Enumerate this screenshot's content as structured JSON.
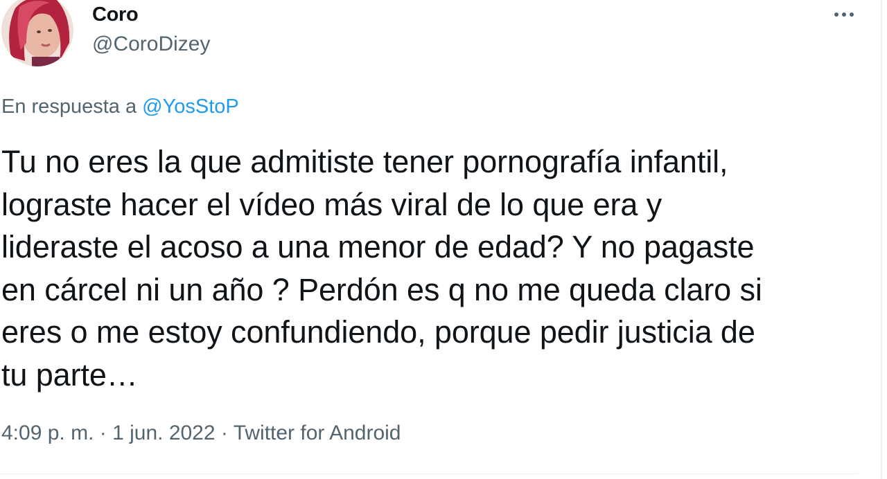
{
  "author": {
    "display_name": "Coro",
    "handle": "@CoroDizey"
  },
  "reply": {
    "prefix": "En respuesta a",
    "mention": "@YosStoP"
  },
  "tweet": {
    "text": "Tu no eres la que admitiste tener pornografía infantil,\nlograste hacer el vídeo más viral de lo que era y\nlideraste el acoso a una menor de edad? Y no pagaste\nen cárcel ni un año ? Perdón es q no me queda claro si\neres o me estoy confundiendo, porque pedir justicia de\ntu parte…"
  },
  "meta": {
    "time": "4:09 p. m.",
    "separator": "·",
    "date": "1 jun. 2022",
    "source": "Twitter for Android"
  },
  "icons": {
    "more": "more-horizontal-icon"
  },
  "colors": {
    "text": "#0f1419",
    "secondary": "#536471",
    "link": "#1d9bf0"
  }
}
